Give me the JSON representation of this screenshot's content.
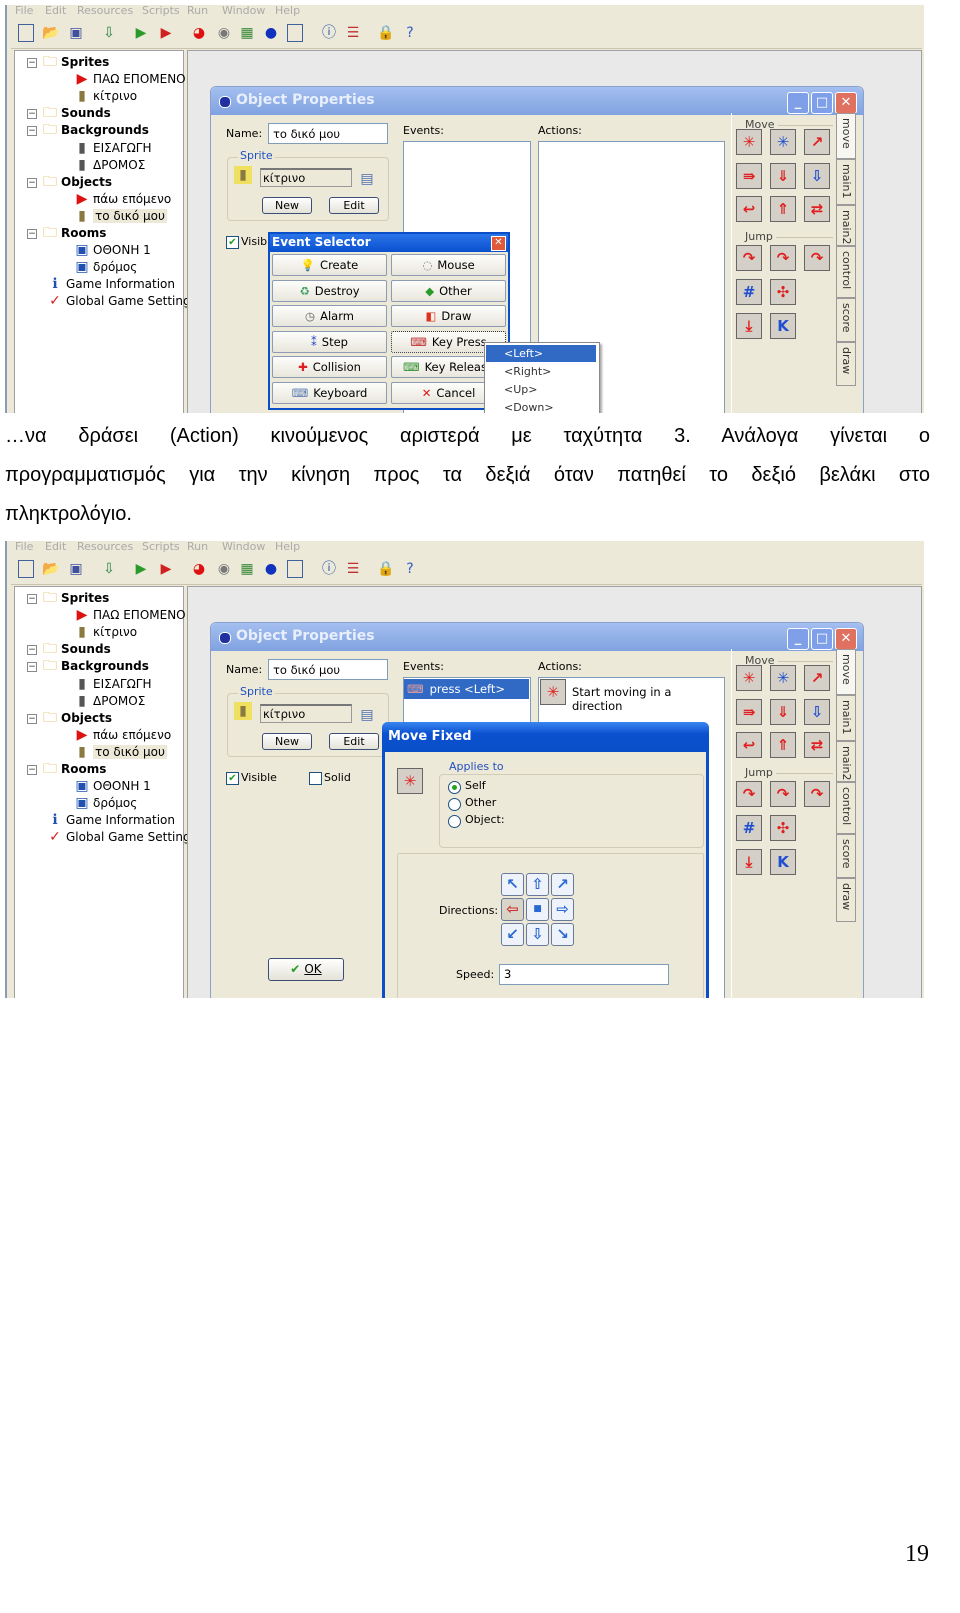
{
  "app": {
    "menu": [
      "File",
      "Edit",
      "Resources",
      "Scripts",
      "Run",
      "Window",
      "Help"
    ],
    "toolbar_icons": [
      "new-file-icon",
      "open-icon",
      "save-icon",
      "publish-icon",
      "run-icon",
      "debug-icon",
      "sprite-icon",
      "sound-icon",
      "background-icon",
      "object-icon",
      "room-icon",
      "game-info-icon",
      "settings-icon",
      "lock-icon",
      "help-icon"
    ],
    "tree": [
      {
        "label": "Sprites",
        "level": 0,
        "bold": true,
        "icon": "folder-icon"
      },
      {
        "label": "ΠΑΩ ΕΠΟΜΕΝΟ",
        "level": 1,
        "icon": "red-arrow-icon"
      },
      {
        "label": "κίτρινο",
        "level": 1,
        "icon": "car-icon"
      },
      {
        "label": "Sounds",
        "level": 0,
        "bold": true,
        "icon": "folder-icon"
      },
      {
        "label": "Backgrounds",
        "level": 0,
        "bold": true,
        "icon": "folder-icon"
      },
      {
        "label": "ΕΙΣΑΓΩΓΗ",
        "level": 1,
        "icon": "background-icon"
      },
      {
        "label": "ΔΡΟΜΟΣ",
        "level": 1,
        "icon": "background-icon"
      },
      {
        "label": "Objects",
        "level": 0,
        "bold": true,
        "icon": "folder-icon"
      },
      {
        "label": "πάω επόμενο",
        "level": 1,
        "icon": "red-arrow-icon"
      },
      {
        "label": "το δικό μου",
        "level": 1,
        "icon": "car-icon",
        "selected": true
      },
      {
        "label": "Rooms",
        "level": 0,
        "bold": true,
        "icon": "folder-icon"
      },
      {
        "label": "ΟΘΟΝΗ 1",
        "level": 1,
        "icon": "room-icon"
      },
      {
        "label": "δρόμος",
        "level": 1,
        "icon": "room-icon"
      },
      {
        "label": "Game Information",
        "level": 0,
        "icon": "info-icon"
      },
      {
        "label": "Global Game Settings",
        "level": 0,
        "icon": "settings-icon"
      }
    ],
    "object_properties": {
      "title": "Object Properties",
      "name_label": "Name:",
      "name_value": "το δικό μου",
      "sprite_legend": "Sprite",
      "sprite_value": "κίτρινο",
      "new_label": "New",
      "edit_label": "Edit",
      "visible_label": "Visible",
      "solid_label": "Solid",
      "events_label": "Events:",
      "actions_label": "Actions:",
      "ok_label": "OK",
      "move_group": "Move",
      "jump_group": "Jump",
      "tabs": [
        "move",
        "main1",
        "main2",
        "control",
        "score",
        "draw"
      ]
    }
  },
  "shot1": {
    "event_selector": {
      "title": "Event Selector",
      "buttons": [
        "Create",
        "Mouse",
        "Destroy",
        "Other",
        "Alarm",
        "Draw",
        "Step",
        "Key Press",
        "Collision",
        "Key Release",
        "Keyboard",
        "Cancel"
      ],
      "key_menu": [
        "<Left>",
        "<Right>",
        "<Up>",
        "<Down>"
      ],
      "key_menu_selected": "<Left>"
    }
  },
  "paragraph": {
    "lines": [
      "…να δράσει (Action) κινούμενος αριστερά με ταχύτητα 3. Ανάλογα γίνεται ο",
      "προγραμματισμός για την κίνηση προς τα δεξιά όταν πατηθεί το δεξιό βελάκι στο",
      "πληκτρολόγιο."
    ]
  },
  "shot2": {
    "event_item": "press <Left>",
    "action_item": "Start moving in a direction",
    "move_fixed": {
      "title": "Move Fixed",
      "applies_to": "Applies to",
      "options": [
        "Self",
        "Other",
        "Object:"
      ],
      "selected_option": "Self",
      "directions_label": "Directions:",
      "selected_direction": "left",
      "speed_label": "Speed:",
      "speed_value": "3"
    }
  },
  "page_number": "19",
  "colors": {
    "xp_blue": "#0a5fd8",
    "inactive_title": "#8aaae0",
    "window_bg": "#ece9d8",
    "selection": "#316ac5"
  }
}
